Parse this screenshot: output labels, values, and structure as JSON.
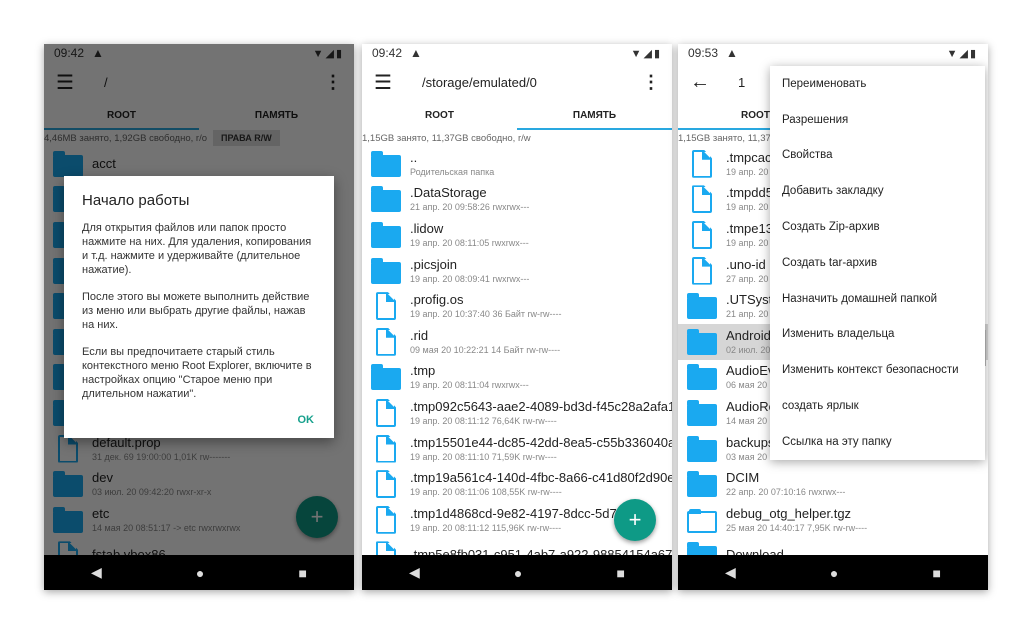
{
  "accent": "#29a8e0",
  "folder_color": "#1aa9f0",
  "fab_color": "#0e9a86",
  "screens": [
    {
      "time": "09:42",
      "path": "/",
      "tabs": [
        "ROOT",
        "ПАМЯТЬ"
      ],
      "active_tab": 0,
      "info": "4,46MB занято, 1,92GB свободно, r/o",
      "rw_button": "ПРАВА R/W",
      "items": [
        {
          "type": "folder",
          "name": "acct",
          "meta": ""
        },
        {
          "type": "folder",
          "name": "",
          "meta": ""
        },
        {
          "type": "folder",
          "name": "",
          "meta": ""
        },
        {
          "type": "folder",
          "name": "",
          "meta": ""
        },
        {
          "type": "folder",
          "name": "",
          "meta": ""
        },
        {
          "type": "folder",
          "name": "",
          "meta": ""
        },
        {
          "type": "folder",
          "name": "",
          "meta": ""
        },
        {
          "type": "folder",
          "name": "",
          "meta": ""
        },
        {
          "type": "doc",
          "name": "default.prop",
          "meta": "31 дек. 69 19:00:00  1,01K  rw-------"
        },
        {
          "type": "folder",
          "name": "dev",
          "meta": "03 июл. 20 09:42:20    rwxr-xr-x"
        },
        {
          "type": "folder",
          "name": "etc",
          "meta": "14 мая 20 08:51:17  -> etc  rwxrwxrwx"
        },
        {
          "type": "doc",
          "name": "fstab.vbox86",
          "meta": ""
        }
      ],
      "dialog": {
        "title": "Начало работы",
        "paragraphs": [
          "Для открытия файлов или папок просто нажмите на них. Для удаления, копирования и т.д. нажмите и удерживайте (длительное нажатие).",
          "После этого вы можете выполнить действие из меню или выбрать другие файлы, нажав на них.",
          "Если вы предпочитаете старый стиль контекстного меню Root Explorer, включите в настройках опцию \"Старое меню при длительном нажатии\"."
        ],
        "ok": "OK"
      }
    },
    {
      "time": "09:42",
      "path": "/storage/emulated/0",
      "tabs": [
        "ROOT",
        "ПАМЯТЬ"
      ],
      "active_tab": 1,
      "info": "1,15GB занято, 11,37GB свободно, r/w",
      "items": [
        {
          "type": "folder",
          "name": "..",
          "meta": "Родительская папка"
        },
        {
          "type": "folder",
          "name": ".DataStorage",
          "meta": "21 апр. 20 09:58:26    rwxrwx---"
        },
        {
          "type": "folder",
          "name": ".lidow",
          "meta": "19 апр. 20 08:11:05    rwxrwx---"
        },
        {
          "type": "folder",
          "name": ".picsjoin",
          "meta": "19 апр. 20 08:09:41    rwxrwx---"
        },
        {
          "type": "file",
          "name": ".profig.os",
          "meta": "19 апр. 20 10:37:40  36 Байт  rw-rw----"
        },
        {
          "type": "file",
          "name": ".rid",
          "meta": "09 мая 20 10:22:21  14 Байт  rw-rw----"
        },
        {
          "type": "folder",
          "name": ".tmp",
          "meta": "19 апр. 20 08:11:04    rwxrwx---"
        },
        {
          "type": "file",
          "name": ".tmp092c5643-aae2-4089-bd3d-f45c28a2afa1",
          "meta": "19 апр. 20 08:11:12  76,64K  rw-rw----"
        },
        {
          "type": "file",
          "name": ".tmp15501e44-dc85-42dd-8ea5-c55b336040a1",
          "meta": "19 апр. 20 08:11:10  71,59K  rw-rw----"
        },
        {
          "type": "file",
          "name": ".tmp19a561c4-140d-4fbc-8a66-c41d80f2d90e",
          "meta": "19 апр. 20 08:11:06  108,55K  rw-rw----"
        },
        {
          "type": "file",
          "name": ".tmp1d4868cd-9e82-4197-8dcc-5d728",
          "meta": "19 апр. 20 08:11:12  115,96K  rw-rw----"
        },
        {
          "type": "file",
          "name": ".tmp5e8fb031-c951-4ab7-a922-98854154a670",
          "meta": ""
        }
      ]
    },
    {
      "time": "09:53",
      "path": "1",
      "tabs": [
        "ROOT",
        ""
      ],
      "active_tab": 0,
      "info": "1,15GB занято, 11,37G",
      "items": [
        {
          "type": "file",
          "name": ".tmpcacfc",
          "meta": "19 апр. 20 08"
        },
        {
          "type": "file",
          "name": ".tmpdd5d",
          "meta": "19 апр. 20 08"
        },
        {
          "type": "file",
          "name": ".tmpe138",
          "meta": "19 апр. 20 08"
        },
        {
          "type": "file",
          "name": ".uno-id",
          "meta": "27 апр. 20 19"
        },
        {
          "type": "folder",
          "name": ".UTSyster",
          "meta": "21 апр. 20 09"
        },
        {
          "type": "folder",
          "name": "Android",
          "meta": "02 июл. 20 15",
          "selected": true
        },
        {
          "type": "folder",
          "name": "AudioEvo",
          "meta": "06 мая 20 16"
        },
        {
          "type": "folder",
          "name": "AudioRec",
          "meta": "14 мая 20 10"
        },
        {
          "type": "folder",
          "name": "backups",
          "meta": "03 мая 20 11:01:18    rwxrwx---"
        },
        {
          "type": "folder",
          "name": "DCIM",
          "meta": "22 апр. 20 07:10:16    rwxrwx---"
        },
        {
          "type": "archive",
          "name": "debug_otg_helper.tgz",
          "meta": "25 мая 20 14:40:17  7,95K  rw-rw----"
        },
        {
          "type": "folder",
          "name": "Download",
          "meta": ""
        }
      ],
      "menu": [
        "Переименовать",
        "Разрешения",
        "Свойства",
        "Добавить закладку",
        "Создать Zip-архив",
        "Создать tar-архив",
        "Назначить домашней папкой",
        "Изменить владельца",
        "Изменить контекст безопасности",
        "создать ярлык",
        "Ссылка на эту папку"
      ]
    }
  ]
}
